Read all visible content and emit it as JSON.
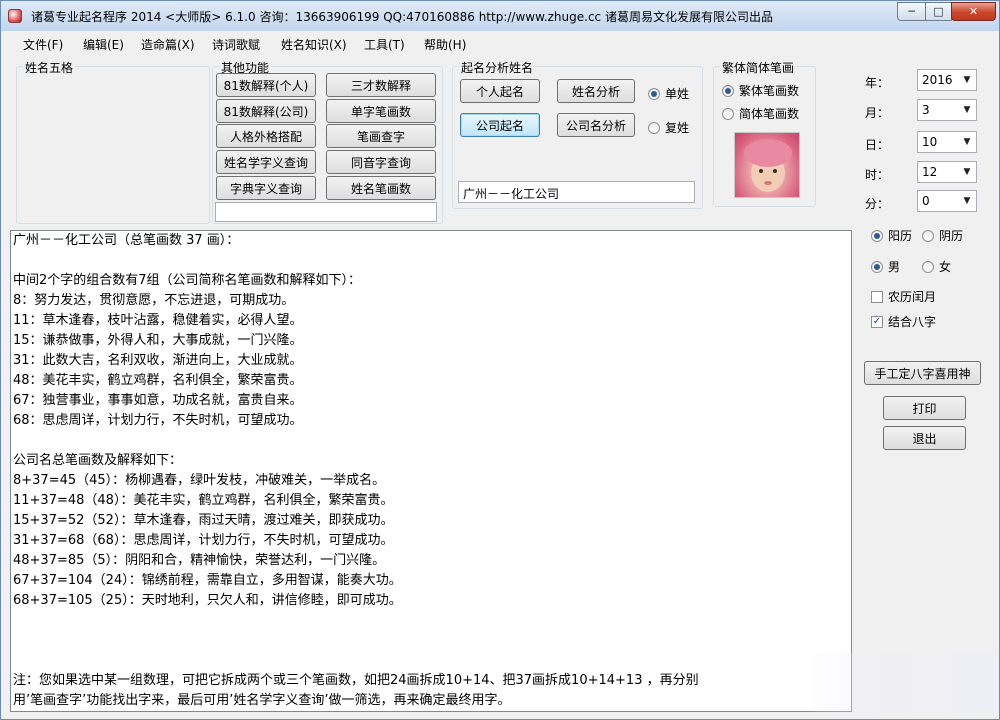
{
  "window": {
    "title": "诸葛专业起名程序  2014  <大师版> 6.1.0    咨询：13663906199 QQ:470160886  http://www.zhuge.cc    诸葛周易文化发展有限公司出品",
    "min": "─",
    "max": "□",
    "close": "✕"
  },
  "menu": [
    "文件(F)",
    "编辑(E)",
    "造命篇(X)",
    "诗词歌赋",
    "姓名知识(X)",
    "工具(T)",
    "帮助(H)"
  ],
  "groups": {
    "wuge": "姓名五格",
    "other": "其他功能",
    "analysis": "起名分析姓名",
    "stroke": "繁体简体笔画"
  },
  "other_buttons": [
    "81数解释(个人)",
    "三才数解释",
    "81数解释(公司)",
    "单字笔画数",
    "人格外格搭配",
    "笔画查字",
    "姓名学字义查询",
    "同音字查询",
    "字典字义查询",
    "姓名笔画数"
  ],
  "analysis": {
    "buttons": [
      "个人起名",
      "姓名分析",
      "公司起名",
      "公司名分析"
    ],
    "radios": [
      "单姓",
      "复姓"
    ],
    "selected_radio": 0,
    "name_value": "广州－－化工公司"
  },
  "stroke": {
    "options": [
      "繁体笔画数",
      "简体笔画数"
    ],
    "selected": 0
  },
  "datetime": [
    {
      "label": "年：",
      "value": "2016"
    },
    {
      "label": "月：",
      "value": "3"
    },
    {
      "label": "日：",
      "value": "10"
    },
    {
      "label": "时：",
      "value": "12"
    },
    {
      "label": "分：",
      "value": "0"
    }
  ],
  "calendar": {
    "options": [
      "阳历",
      "阴历"
    ],
    "selected": 0
  },
  "gender": {
    "options": [
      "男",
      "女"
    ],
    "selected": 0
  },
  "checks": [
    {
      "label": "农历闰月",
      "checked": false
    },
    {
      "label": "结合八字",
      "checked": true
    }
  ],
  "right_buttons": {
    "bazi": "手工定八字喜用神",
    "print": "打印",
    "exit": "退出"
  },
  "result_lines": [
    "广州－－化工公司（总笔画数 37 画）：",
    "",
    "中间2个字的组合数有7组（公司简称名笔画数和解释如下）：",
    "8：努力发达，贯彻意愿，不忘进退，可期成功。",
    "11：草木逢春，枝叶沾露，稳健着实，必得人望。",
    "15：谦恭做事，外得人和，大事成就，一门兴隆。",
    "31：此数大吉，名利双收，渐进向上，大业成就。",
    "48：美花丰实，鹤立鸡群，名利俱全，繁荣富贵。",
    "67：独营事业，事事如意，功成名就，富贵自来。",
    "68：思虑周详，计划力行，不失时机，可望成功。",
    "",
    "公司名总笔画数及解释如下：",
    "8+37=45（45）：杨柳遇春，绿叶发枝，冲破难关，一举成名。",
    "11+37=48（48）：美花丰实，鹤立鸡群，名利俱全，繁荣富贵。",
    "15+37=52（52）：草木逢春，雨过天晴，渡过难关，即获成功。",
    "31+37=68（68）：思虑周详，计划力行，不失时机，可望成功。",
    "48+37=85（5）：阴阳和合，精神愉快，荣誉达利，一门兴隆。",
    "67+37=104（24）：锦绣前程，需靠自立，多用智谋，能奏大功。",
    "68+37=105（25）：天时地利，只欠人和，讲信修睦，即可成功。",
    "",
    "",
    "",
    "注：您如果选中某一组数理，可把它拆成两个或三个笔画数，如把24画拆成10+14、把37画拆成10+14+13 ，再分别",
    "用’笔画查字’功能找出字来，最后可用’姓名学字义查询’做一筛选，再来确定最终用字。"
  ]
}
